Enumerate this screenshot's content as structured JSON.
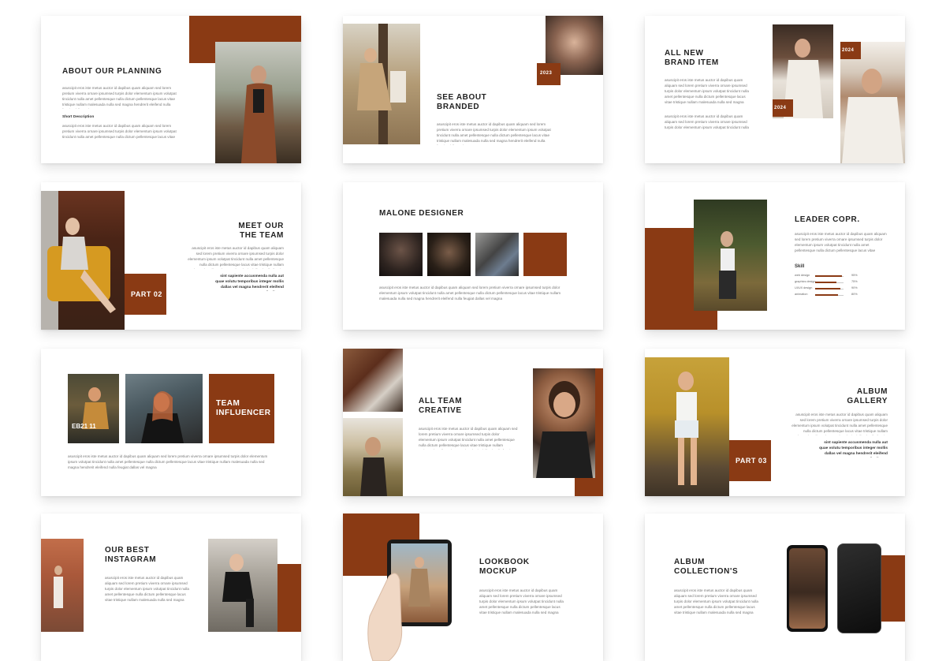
{
  "colors": {
    "accent": "#8a3a14"
  },
  "body": "asuscipit eros iste metus auctor id dapibus quam aliquam sed lorem pretium viverra ornare ipsumsed turpis dolor elementum ipsum volutpat tincidunt nulla amet pellentesque nulla dictum pellentesque lacus vitae tristique nullam malesuada nulla sed magna hendrerit eleifend nulla feugiat dallas vel magna",
  "slides": {
    "s1": {
      "title": "ABOUT OUR PLANNING",
      "sub": "Short Description"
    },
    "s2": {
      "title": "SEE ABOUT\nBRANDED",
      "year": "2023"
    },
    "s3": {
      "title": "ALL NEW\nBRAND ITEM",
      "year": "2024"
    },
    "s4": {
      "title": "MEET OUR\nTHE TEAM",
      "badge": "PART 02",
      "note": "sint sapiente accusmenda nulla aut quae volutu temporibus integer mollis dallas vel magna hendrerit eleifend nulla dictum"
    },
    "s5": {
      "title": "MALONE DESIGNER"
    },
    "s6": {
      "title": "LEADER COPR.",
      "skill_title": "Skill",
      "skills": [
        {
          "label": "web design",
          "value": 95
        },
        {
          "label": "graphics design",
          "value": 75
        },
        {
          "label": "UI/UX design",
          "value": 90
        },
        {
          "label": "animation",
          "value": 80
        }
      ]
    },
    "s7": {
      "title": "TEAM\nINFLUENCER",
      "photo_text": "EB21 11"
    },
    "s8": {
      "title": "ALL TEAM\nCREATIVE"
    },
    "s9": {
      "title": "ALBUM\nGALLERY",
      "badge": "PART 03",
      "note": "sint sapiente accusmenda nulla aut quae volutu temporibus integer mollis dallas vel magna hendrerit eleifend nulla dictum"
    },
    "s10": {
      "title": "OUR BEST\nINSTAGRAM"
    },
    "s11": {
      "title": "LOOKBOOK\nMOCKUP"
    },
    "s12": {
      "title": "ALBUM\nCOLLECTION'S"
    }
  }
}
